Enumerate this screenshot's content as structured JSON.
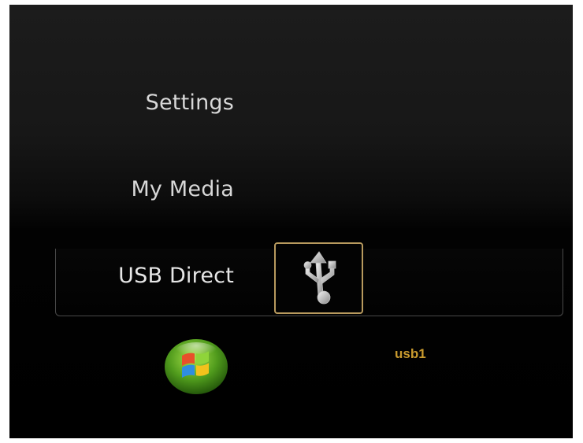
{
  "menu": {
    "items": [
      {
        "label": "Settings"
      },
      {
        "label": "My Media"
      },
      {
        "label": "USB Direct",
        "selected": true
      }
    ]
  },
  "selected_tile": {
    "icon": "usb-icon"
  },
  "device": {
    "label": "usb1"
  },
  "footer": {
    "logo_icon": "windows-media-center-logo"
  },
  "colors": {
    "accent_gold": "#c99a2e",
    "tile_border": "#b89a5e",
    "menu_text": "#d8d8d8",
    "background": "#000000"
  }
}
